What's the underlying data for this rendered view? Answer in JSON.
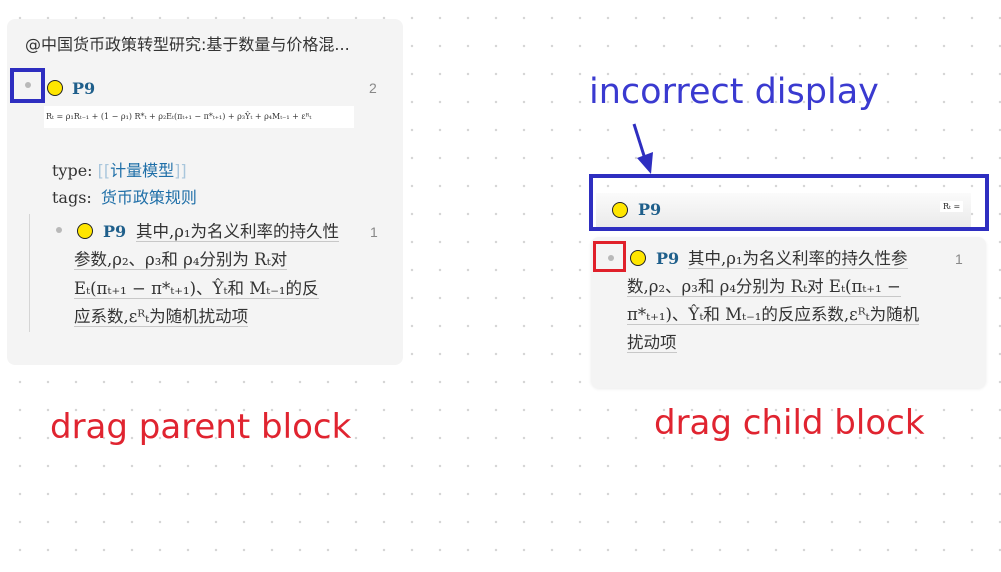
{
  "parent_card": {
    "title": "@中国货币政策转型研究:基于数量与价格混...",
    "block": {
      "ref": "P9",
      "count": "2",
      "formula": "Rₜ = ρ₁Rₜ₋₁ + (1 − ρ₁) R*ₜ + ρ₂Eₜ(πₜ₊₁ − π*ₜ₊₁) + ρ₃Ŷₜ + ρ₄Mₜ₋₁ + εᴿₜ",
      "type_key": "type:",
      "type_open": "[[",
      "type_value": "计量模型",
      "type_close": "]]",
      "tags_key": "tags:",
      "tags_value": "货币政策规则"
    },
    "child": {
      "ref": "P9",
      "count": "1",
      "line1": "其中,ρ₁为名义利率的持久性",
      "line2": "参数,ρ₂、ρ₃和 ρ₄分别为 Rₜ对",
      "line3": "Eₜ(πₜ₊₁ − π*ₜ₊₁)、Ŷₜ和 Mₜ₋₁的反",
      "line4": "应系数,εᴿₜ为随机扰动项"
    }
  },
  "drag_ghost": {
    "ref": "P9",
    "formula": "Rₜ ="
  },
  "child_card": {
    "ref": "P9",
    "count": "1",
    "line1": "其中,ρ₁为名义利率的持久性参",
    "line2": "数,ρ₂、ρ₃和 ρ₄分别为 Rₜ对 Eₜ(πₜ₊₁ −",
    "line3": "π*ₜ₊₁)、Ŷₜ和 Mₜ₋₁的反应系数,εᴿₜ为随机",
    "line4": "扰动项"
  },
  "annotations": {
    "incorrect_display": "incorrect display",
    "drag_parent": "drag parent block",
    "drag_child": "drag child block"
  },
  "colors": {
    "annotation_blue": "#2e2ec0",
    "annotation_red": "#e0202a",
    "ref_link": "#1f5f8b",
    "tag_link": "#1f6fa8",
    "bullet_highlight": "#ffe600"
  }
}
